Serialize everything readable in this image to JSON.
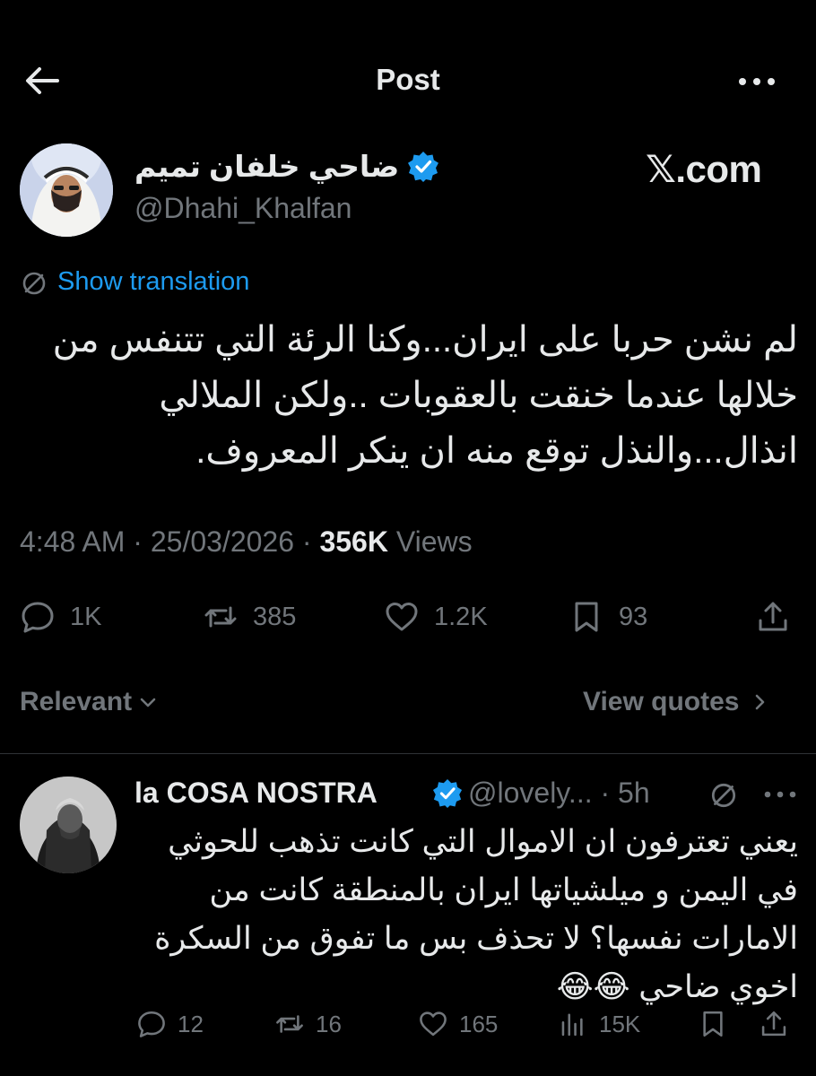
{
  "header": {
    "title": "Post",
    "back_icon": "back-arrow-icon",
    "more_icon": "more-icon"
  },
  "post": {
    "author_name": "ضاحي خلفان تميم",
    "author_handle": "@Dhahi_Khalfan",
    "watermark": "𝕏.com",
    "show_translation": "Show translation",
    "text": "لم نشن حربا على ايران...وكنا الرئة التي تتنفس من خلالها عندما خنقت بالعقوبات ..ولكن الملالي انذال...والنذل توقع منه ان ينكر المعروف.",
    "time": "4:48 AM",
    "date": "25/03/2026",
    "views_count": "356K",
    "views_label": "Views",
    "actions": {
      "replies": "1K",
      "reposts": "385",
      "likes": "1.2K",
      "bookmarks": "93"
    }
  },
  "filters": {
    "sort_label": "Relevant",
    "view_quotes_label": "View quotes"
  },
  "reply": {
    "author_name": "la COSA NOSTRA",
    "author_handle": "@lovely...",
    "time": "5h",
    "text": "يعني تعترفون ان الاموال التي كانت تذهب للحوثي في اليمن و ميلشياتها ايران بالمنطقة كانت من الامارات نفسها؟ لا تحذف بس ما تفوق من السكرة اخوي ضاحي 😂😂",
    "actions": {
      "replies": "12",
      "reposts": "16",
      "likes": "165",
      "views": "15K"
    }
  },
  "colors": {
    "accent": "#1d9bf0",
    "muted": "#71767b",
    "background": "#000000",
    "text": "#e7e9ea"
  }
}
